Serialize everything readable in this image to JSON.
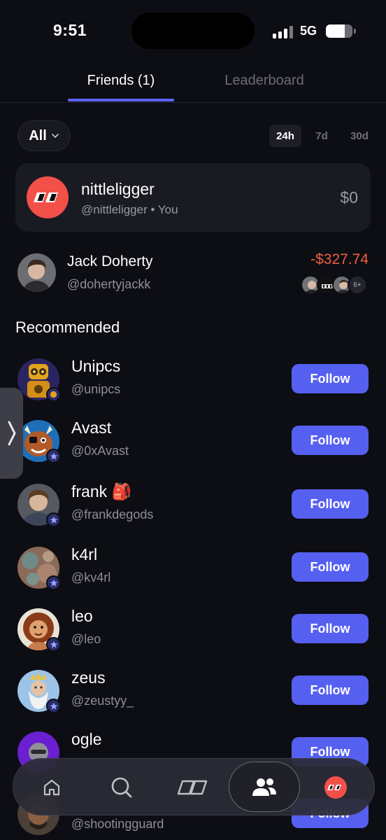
{
  "status_bar": {
    "time": "9:51",
    "network": "5G",
    "battery_level": 0.72
  },
  "tabs": [
    {
      "label": "Friends (1)",
      "active": true
    },
    {
      "label": "Leaderboard",
      "active": false
    }
  ],
  "filter": {
    "label": "All",
    "icon": "chevron-down-icon"
  },
  "time_ranges": [
    {
      "label": "24h",
      "active": true
    },
    {
      "label": "7d",
      "active": false
    },
    {
      "label": "30d",
      "active": false
    }
  ],
  "me": {
    "name": "nittleligger",
    "handle": "@nittleligger • You",
    "value": "$0"
  },
  "friends": [
    {
      "name": "Jack Doherty",
      "handle": "@dohertyjackk",
      "pnl": "-$327.74",
      "more_count": "6+"
    }
  ],
  "recommended_title": "Recommended",
  "recommended": [
    {
      "name": "Unipcs",
      "handle": "@unipcs",
      "button": "Follow"
    },
    {
      "name": "Avast",
      "handle": "@0xAvast",
      "button": "Follow"
    },
    {
      "name": "frank 🎒",
      "handle": "@frankdegods",
      "button": "Follow"
    },
    {
      "name": "k4rl",
      "handle": "@kv4rl",
      "button": "Follow"
    },
    {
      "name": "leo",
      "handle": "@leo",
      "button": "Follow"
    },
    {
      "name": "zeus",
      "handle": "@zeustyy_",
      "button": "Follow"
    },
    {
      "name": "ogle",
      "handle": "",
      "button": "Follow"
    },
    {
      "name": "",
      "handle": "@shootingguard",
      "button": "Follow"
    }
  ],
  "nav": [
    {
      "icon": "home-icon"
    },
    {
      "icon": "search-icon"
    },
    {
      "icon": "logo-icon"
    },
    {
      "icon": "friends-icon",
      "active": true
    },
    {
      "icon": "profile-avatar-icon"
    }
  ],
  "colors": {
    "accent": "#5560f0",
    "negative": "#f0603c",
    "brand_red": "#f4504a",
    "background": "#0d0d14"
  }
}
